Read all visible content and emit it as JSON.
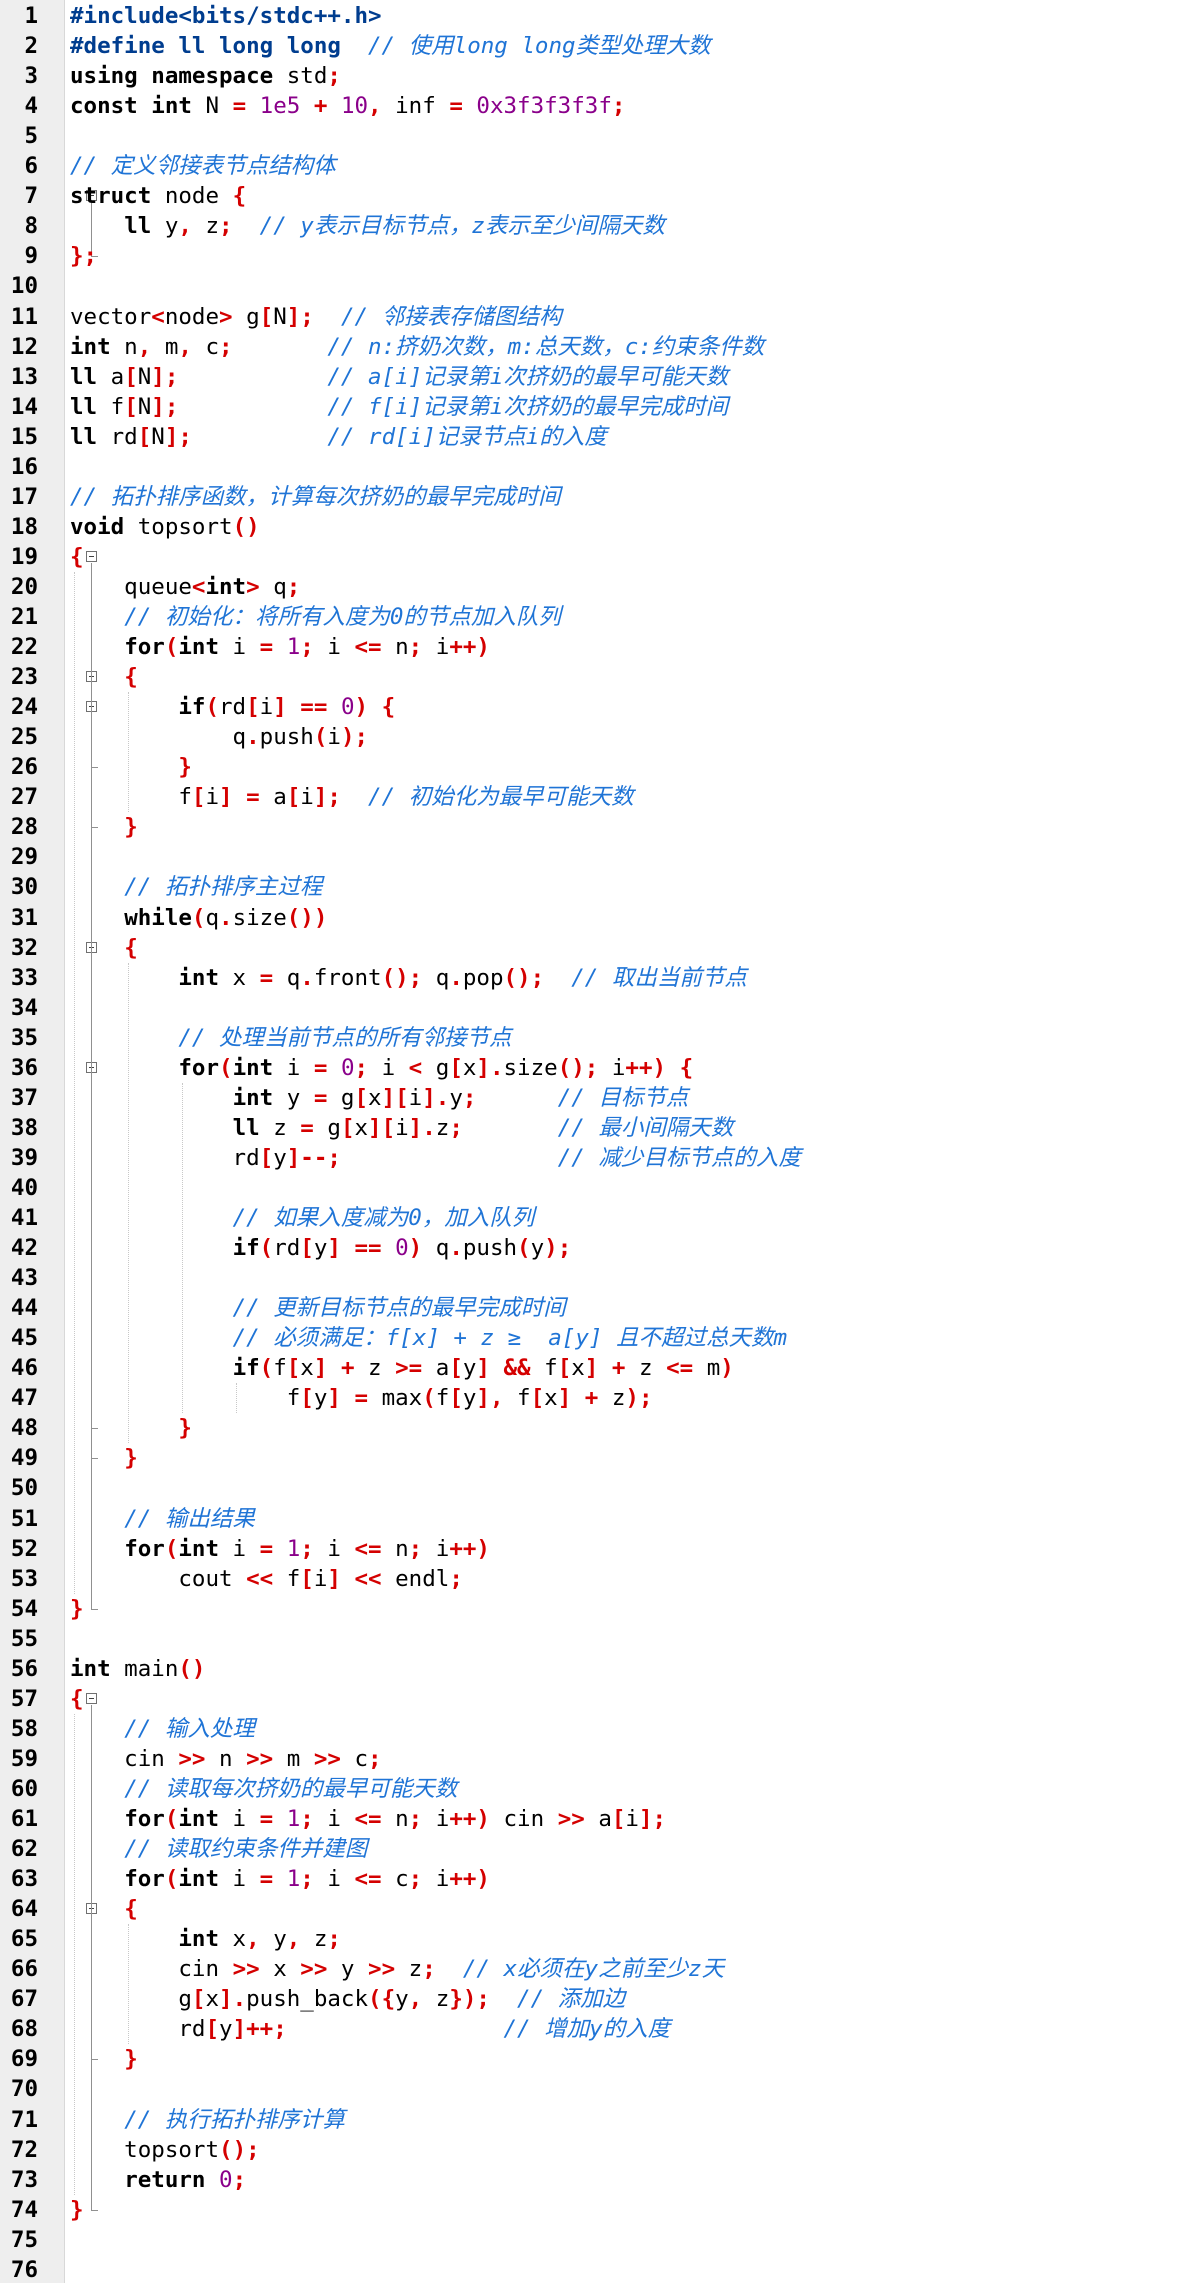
{
  "editor": {
    "lines": [
      {
        "n": "1",
        "t": "#include<bits/stdc++.h>"
      },
      {
        "n": "2",
        "t": "#define ll long long  // 使用long long类型处理大数"
      },
      {
        "n": "3",
        "t": "using namespace std;"
      },
      {
        "n": "4",
        "t": "const int N = 1e5 + 10, inf = 0x3f3f3f3f;"
      },
      {
        "n": "5",
        "t": ""
      },
      {
        "n": "6",
        "t": "// 定义邻接表节点结构体"
      },
      {
        "n": "7",
        "t": "struct node {"
      },
      {
        "n": "8",
        "t": "    ll y, z;  // y表示目标节点，z表示至少间隔天数"
      },
      {
        "n": "9",
        "t": "};"
      },
      {
        "n": "10",
        "t": ""
      },
      {
        "n": "11",
        "t": "vector<node> g[N];  // 邻接表存储图结构"
      },
      {
        "n": "12",
        "t": "int n, m, c;       // n:挤奶次数，m:总天数，c:约束条件数"
      },
      {
        "n": "13",
        "t": "ll a[N];           // a[i]记录第i次挤奶的最早可能天数"
      },
      {
        "n": "14",
        "t": "ll f[N];           // f[i]记录第i次挤奶的最早完成时间"
      },
      {
        "n": "15",
        "t": "ll rd[N];          // rd[i]记录节点i的入度"
      },
      {
        "n": "16",
        "t": ""
      },
      {
        "n": "17",
        "t": "// 拓扑排序函数，计算每次挤奶的最早完成时间"
      },
      {
        "n": "18",
        "t": "void topsort()"
      },
      {
        "n": "19",
        "t": "{"
      },
      {
        "n": "20",
        "t": "    queue<int> q;"
      },
      {
        "n": "21",
        "t": "    // 初始化：将所有入度为0的节点加入队列"
      },
      {
        "n": "22",
        "t": "    for(int i = 1; i <= n; i++)"
      },
      {
        "n": "23",
        "t": "    {"
      },
      {
        "n": "24",
        "t": "        if(rd[i] == 0) {"
      },
      {
        "n": "25",
        "t": "            q.push(i);"
      },
      {
        "n": "26",
        "t": "        }"
      },
      {
        "n": "27",
        "t": "        f[i] = a[i];  // 初始化为最早可能天数"
      },
      {
        "n": "28",
        "t": "    }"
      },
      {
        "n": "29",
        "t": ""
      },
      {
        "n": "30",
        "t": "    // 拓扑排序主过程"
      },
      {
        "n": "31",
        "t": "    while(q.size())"
      },
      {
        "n": "32",
        "t": "    {"
      },
      {
        "n": "33",
        "t": "        int x = q.front(); q.pop();  // 取出当前节点"
      },
      {
        "n": "34",
        "t": ""
      },
      {
        "n": "35",
        "t": "        // 处理当前节点的所有邻接节点"
      },
      {
        "n": "36",
        "t": "        for(int i = 0; i < g[x].size(); i++) {"
      },
      {
        "n": "37",
        "t": "            int y = g[x][i].y;      // 目标节点"
      },
      {
        "n": "38",
        "t": "            ll z = g[x][i].z;       // 最小间隔天数"
      },
      {
        "n": "39",
        "t": "            rd[y]--;                // 减少目标节点的入度"
      },
      {
        "n": "40",
        "t": ""
      },
      {
        "n": "41",
        "t": "            // 如果入度减为0，加入队列"
      },
      {
        "n": "42",
        "t": "            if(rd[y] == 0) q.push(y);"
      },
      {
        "n": "43",
        "t": ""
      },
      {
        "n": "44",
        "t": "            // 更新目标节点的最早完成时间"
      },
      {
        "n": "45",
        "t": "            // 必须满足：f[x] + z ≥  a[y] 且不超过总天数m"
      },
      {
        "n": "46",
        "t": "            if(f[x] + z >= a[y] && f[x] + z <= m)"
      },
      {
        "n": "47",
        "t": "                f[y] = max(f[y], f[x] + z);"
      },
      {
        "n": "48",
        "t": "        }"
      },
      {
        "n": "49",
        "t": "    }"
      },
      {
        "n": "50",
        "t": ""
      },
      {
        "n": "51",
        "t": "    // 输出结果"
      },
      {
        "n": "52",
        "t": "    for(int i = 1; i <= n; i++)"
      },
      {
        "n": "53",
        "t": "        cout << f[i] << endl;"
      },
      {
        "n": "54",
        "t": "}"
      },
      {
        "n": "55",
        "t": ""
      },
      {
        "n": "56",
        "t": "int main()"
      },
      {
        "n": "57",
        "t": "{"
      },
      {
        "n": "58",
        "t": "    // 输入处理"
      },
      {
        "n": "59",
        "t": "    cin >> n >> m >> c;"
      },
      {
        "n": "60",
        "t": "    // 读取每次挤奶的最早可能天数"
      },
      {
        "n": "61",
        "t": "    for(int i = 1; i <= n; i++) cin >> a[i];"
      },
      {
        "n": "62",
        "t": "    // 读取约束条件并建图"
      },
      {
        "n": "63",
        "t": "    for(int i = 1; i <= c; i++)"
      },
      {
        "n": "64",
        "t": "    {"
      },
      {
        "n": "65",
        "t": "        int x, y, z;"
      },
      {
        "n": "66",
        "t": "        cin >> x >> y >> z;  // x必须在y之前至少z天"
      },
      {
        "n": "67",
        "t": "        g[x].push_back({y, z});  // 添加边"
      },
      {
        "n": "68",
        "t": "        rd[y]++;                // 增加y的入度"
      },
      {
        "n": "69",
        "t": "    }"
      },
      {
        "n": "70",
        "t": ""
      },
      {
        "n": "71",
        "t": "    // 执行拓扑排序计算"
      },
      {
        "n": "72",
        "t": "    topsort();"
      },
      {
        "n": "73",
        "t": "    return 0;"
      },
      {
        "n": "74",
        "t": "}"
      },
      {
        "n": "75",
        "t": ""
      },
      {
        "n": "76",
        "t": ""
      }
    ],
    "fold_markers": [
      7,
      19,
      23,
      24,
      32,
      36,
      57,
      64
    ],
    "colors": {
      "keyword": "#000000",
      "operator": "#d40000",
      "number": "#8a008a",
      "comment": "#1f74d6",
      "gutter": "#eeeeee"
    }
  }
}
